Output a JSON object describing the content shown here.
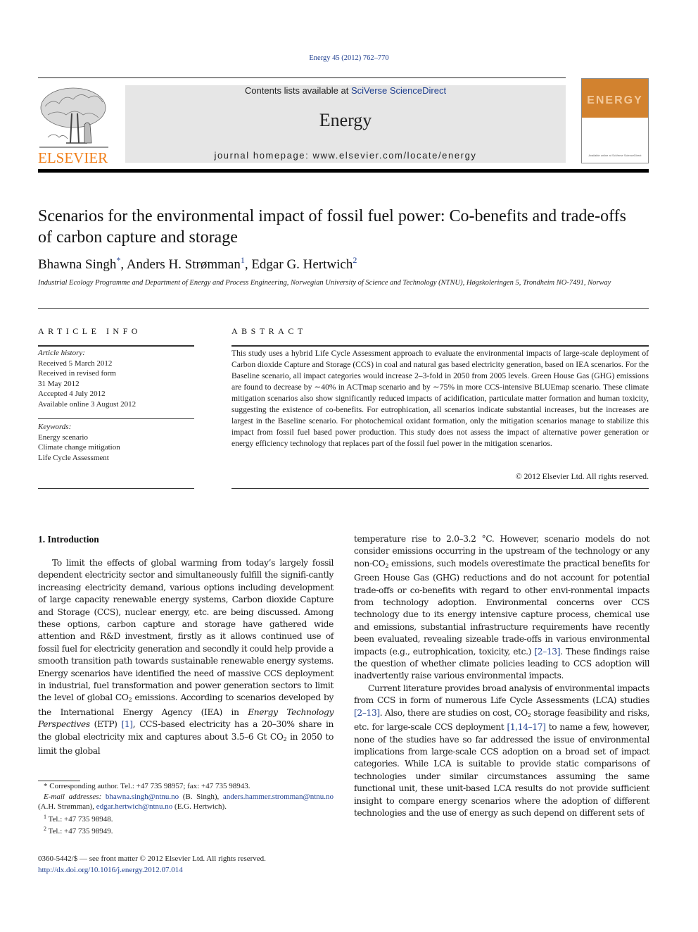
{
  "header": {
    "citation": "Energy 45 (2012) 762–770",
    "publisher_logo_text": "ELSEVIER",
    "contents_prefix": "Contents lists available at ",
    "contents_link": "SciVerse ScienceDirect",
    "journal_name": "Energy",
    "homepage": "journal homepage: www.elsevier.com/locate/energy",
    "cover_title": "ENERGY",
    "cover_footer": "Available online at SciVerse ScienceDirect",
    "colors": {
      "elsevier_orange": "#f07f1a",
      "link_blue": "#1f3f8f",
      "cover_orange": "#d2822f",
      "banner_gray": "#e6e6e6"
    }
  },
  "article": {
    "title": "Scenarios for the environmental impact of fossil fuel power: Co-benefits and trade-offs of carbon capture and storage",
    "authors": [
      {
        "name": "Bhawna Singh",
        "mark": "*"
      },
      {
        "name": "Anders H. Strømman",
        "mark": "1"
      },
      {
        "name": "Edgar G. Hertwich",
        "mark": "2"
      }
    ],
    "affiliation": "Industrial Ecology Programme and Department of Energy and Process Engineering, Norwegian University of Science and Technology (NTNU), Høgskoleringen 5, Trondheim NO-7491, Norway"
  },
  "article_info": {
    "heading": "ARTICLE INFO",
    "history_label": "Article history:",
    "history": [
      "Received 5 March 2012",
      "Received in revised form",
      "31 May 2012",
      "Accepted 4 July 2012",
      "Available online 3 August 2012"
    ],
    "keywords_label": "Keywords:",
    "keywords": [
      "Energy scenario",
      "Climate change mitigation",
      "Life Cycle Assessment"
    ]
  },
  "abstract": {
    "heading": "ABSTRACT",
    "text": "This study uses a hybrid Life Cycle Assessment approach to evaluate the environmental impacts of large-scale deployment of Carbon dioxide Capture and Storage (CCS) in coal and natural gas based electricity generation, based on IEA scenarios. For the Baseline scenario, all impact categories would increase 2–3-fold in 2050 from 2005 levels. Green House Gas (GHG) emissions are found to decrease by ∼40% in ACTmap scenario and by ∼75% in more CCS-intensive BLUEmap scenario. These climate mitigation scenarios also show significantly reduced impacts of acidification, particulate matter formation and human toxicity, suggesting the existence of co-benefits. For eutrophication, all scenarios indicate substantial increases, but the increases are largest in the Baseline scenario. For photochemical oxidant formation, only the mitigation scenarios manage to stabilize this impact from fossil fuel based power production. This study does not assess the impact of alternative power generation or energy efficiency technology that replaces part of the fossil fuel power in the mitigation scenarios.",
    "copyright": "© 2012 Elsevier Ltd. All rights reserved."
  },
  "introduction": {
    "heading": "1.  Introduction",
    "left_p1_a": "To limit the effects of global warming from today’s largely fossil dependent electricity sector and simultaneously fulfill the signifi-cantly increasing electricity demand, various options including development of large capacity renewable energy systems, Carbon dioxide Capture and Storage (CCS), nuclear energy, etc. are being discussed. Among these options, carbon capture and storage have gathered wide attention and R&D investment, firstly as it allows continued use of fossil fuel for electricity generation and secondly it could help provide a smooth transition path towards sustainable renewable energy systems. Energy scenarios have identified the need of massive CCS deployment in industrial, fuel transformation and power generation sectors to limit the level of global CO",
    "left_p1_b": " emissions. According to scenarios developed by the International Energy Agency (IEA) in ",
    "left_p1_italic": "Energy Technology Perspectives",
    "left_p1_c": " (ETP) ",
    "ref_1": "[1]",
    "left_p1_d": ", CCS-based electricity has a 20–30% share in the global electricity mix and captures about 3.5–6 Gt CO",
    "left_p1_e": " in 2050 to limit the global",
    "right_p1_a": "temperature rise to 2.0–3.2 °C. However, scenario models do not consider emissions occurring in the upstream of the technology or any non-CO",
    "right_p1_b": " emissions, such models overestimate the practical benefits for Green House Gas (GHG) reductions and do not account for potential trade-offs or co-benefits with regard to other envi-ronmental impacts from technology adoption. Environmental concerns over CCS technology due to its energy intensive capture process, chemical use and emissions, substantial infrastructure requirements have recently been evaluated, revealing sizeable trade-offs in various environmental impacts (e.g., eutrophication, toxicity, etc.) ",
    "ref_2_13": "[2–13]",
    "right_p1_c": ". These findings raise the question of whether climate policies leading to CCS adoption will inadvertently raise various environmental impacts.",
    "right_p2_a": "Current literature provides broad analysis of environmental impacts from CCS in form of numerous Life Cycle Assessments (LCA) studies ",
    "right_p2_b": ". Also, there are studies on cost, CO",
    "right_p2_c": " storage feasibility and risks, etc. for large-scale CCS deployment ",
    "ref_1_14_17": "[1,14–17]",
    "right_p2_d": " to name a few, however, none of the studies have so far addressed the issue of environmental implications from large-scale CCS adoption on a broad set of impact categories. While LCA is suitable to provide static comparisons of technologies under similar circumstances assuming the same functional unit, these unit-based LCA results do not provide sufficient insight to compare energy scenarios where the adoption of different technologies and the use of energy as such depend on different sets of",
    "subscript_2": "2"
  },
  "footnotes": {
    "corresponding": "Corresponding author. Tel.: +47 735 98957; fax: +47 735 98943.",
    "corresponding_mark": "*",
    "email_label": "E-mail addresses:",
    "email_1": "bhawna.singh@ntnu.no",
    "email_1_name": " (B. Singh), ",
    "email_2": "anders.hammer.stromman@ntnu.no",
    "email_2_name": " (A.H. Strømman), ",
    "email_3": "edgar.hertwich@ntnu.no",
    "email_3_name": " (E.G. Hertwich).",
    "fn1_mark": "1",
    "fn1": "Tel.: +47 735 98948.",
    "fn2_mark": "2",
    "fn2": "Tel.: +47 735 98949."
  },
  "front_matter": {
    "issn_line": "0360-5442/$ — see front matter © 2012 Elsevier Ltd. All rights reserved.",
    "doi": "http://dx.doi.org/10.1016/j.energy.2012.07.014"
  }
}
